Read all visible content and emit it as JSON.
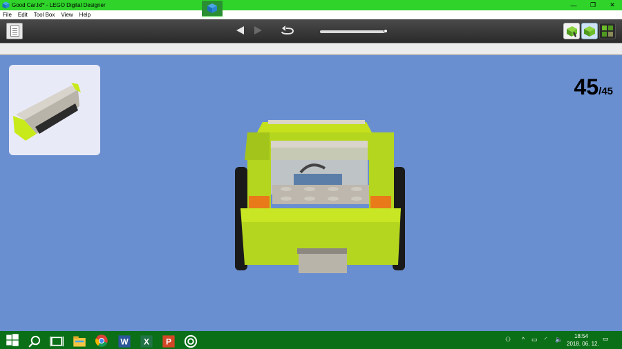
{
  "window": {
    "title": "Good Car.lxf* - LEGO Digital Designer",
    "minimize": "—",
    "restore": "❐",
    "close": "✕"
  },
  "menu": {
    "file": "File",
    "edit": "Edit",
    "toolbox": "Tool Box",
    "view": "View",
    "help": "Help"
  },
  "toolbar": {
    "prev_icon": "arrow-left-icon",
    "next_icon": "arrow-right-icon",
    "rotate_icon": "rotate-icon",
    "slider_value": 1.0
  },
  "viewport": {
    "step_current": "45",
    "step_separator": "/",
    "step_total": "45",
    "background": "#6a8fd0"
  },
  "taskbar": {
    "clock_time": "18:54",
    "clock_date": "2018. 06. 12."
  },
  "colors": {
    "titlebar": "#2fd32a",
    "taskbar": "#0a6f16",
    "lime": "#b5d61f",
    "grey": "#b9b4aa"
  }
}
